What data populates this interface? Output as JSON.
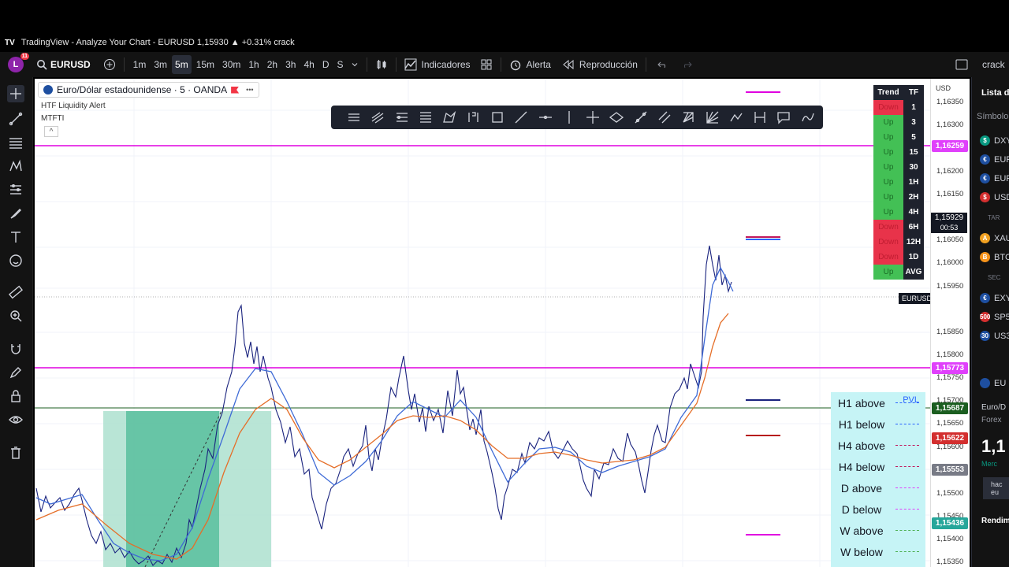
{
  "window": {
    "title": "TradingView - Analyze Your Chart - EURUSD 1,15930 ▲ +0.31% crack"
  },
  "toolbar": {
    "avatar_letter": "L",
    "avatar_badge": "11",
    "symbol": "EURUSD",
    "intervals": [
      "1m",
      "3m",
      "5m",
      "15m",
      "30m",
      "1h",
      "2h",
      "3h",
      "4h",
      "D",
      "S"
    ],
    "active_interval": "5m",
    "indicators_label": "Indicadores",
    "alert_label": "Alerta",
    "replay_label": "Reproducción",
    "right_label": "crack"
  },
  "legend": {
    "symbol_title": "Euro/Dólar estadounidense · 5 · OANDA",
    "more": "•••",
    "indicator_1": "HTF Liquidity Alert",
    "indicator_2": "MTFTI",
    "collapse": "^"
  },
  "trend_table": {
    "header_trend": "Trend",
    "header_tf": "TF",
    "rows": [
      {
        "trend": "Down",
        "tf": "1"
      },
      {
        "trend": "Up",
        "tf": "3"
      },
      {
        "trend": "Up",
        "tf": "5"
      },
      {
        "trend": "Up",
        "tf": "15"
      },
      {
        "trend": "Up",
        "tf": "30"
      },
      {
        "trend": "Up",
        "tf": "1H"
      },
      {
        "trend": "Up",
        "tf": "2H"
      },
      {
        "trend": "Up",
        "tf": "4H"
      },
      {
        "trend": "Down",
        "tf": "6H"
      },
      {
        "trend": "Down",
        "tf": "12H"
      },
      {
        "trend": "Down",
        "tf": "1D"
      },
      {
        "trend": "Up",
        "tf": "AVG"
      }
    ]
  },
  "levels": {
    "pvl": "PVL",
    "rows": [
      {
        "label": "H1 above",
        "color": "#2962ff"
      },
      {
        "label": "H1 below",
        "color": "#2962ff"
      },
      {
        "label": "H4 above",
        "color": "#c2185b"
      },
      {
        "label": "H4 below",
        "color": "#c2185b"
      },
      {
        "label": "D above",
        "color": "#e040fb"
      },
      {
        "label": "D below",
        "color": "#e040fb"
      },
      {
        "label": "W above",
        "color": "#4caf50"
      },
      {
        "label": "W below",
        "color": "#4caf50"
      }
    ]
  },
  "price_axis": {
    "currency": "USD",
    "ticks": [
      "1,16350",
      "1,16300",
      "1,16250",
      "1,16200",
      "1,16150",
      "1,16100",
      "1,16050",
      "1,16000",
      "1,15950",
      "1,15850",
      "1,15800",
      "1,15750",
      "1,15700",
      "1,15650",
      "1,15600",
      "1,15500",
      "1,15450",
      "1,15400",
      "1,15350"
    ],
    "tags": [
      {
        "text": "1,16259",
        "color": "#e040fb"
      },
      {
        "text": "1,15773",
        "color": "#e040fb"
      },
      {
        "text": "1,15687",
        "color": "#1b5e20"
      },
      {
        "text": "1,15622",
        "color": "#d32f2f"
      },
      {
        "text": "1,15553",
        "color": "#787b86"
      },
      {
        "text": "1,15436",
        "color": "#26a69a"
      }
    ],
    "symbol_tag": "EURUSD",
    "current_price": "1,15929",
    "countdown": "00:53"
  },
  "watchlist": {
    "title": "Lista d",
    "search": "Símbolo",
    "items": [
      {
        "icon": "$",
        "color": "#089981",
        "text": "DXY"
      },
      {
        "icon": "€",
        "color": "#1e4fa0",
        "text": "EUR"
      },
      {
        "icon": "€",
        "color": "#1e4fa0",
        "text": "EUR"
      },
      {
        "icon": "$",
        "color": "#d32f2f",
        "text": "USD"
      },
      {
        "icon": "",
        "color": "",
        "text": "TAR"
      },
      {
        "icon": "A",
        "color": "#f0a020",
        "text": "XAU"
      },
      {
        "icon": "B",
        "color": "#f7931a",
        "text": "BTC"
      },
      {
        "icon": "",
        "color": "",
        "text": "SEC"
      },
      {
        "icon": "€",
        "color": "#1e4fa0",
        "text": "EXY"
      },
      {
        "icon": "500",
        "color": "#d32f2f",
        "text": "SP5"
      },
      {
        "icon": "30",
        "color": "#1e4fa0",
        "text": "US3"
      }
    ],
    "detail_symbol": "EU",
    "detail_name": "Euro/D",
    "detail_type": "Forex",
    "detail_price": "1,1",
    "detail_status": "Merc",
    "detail_promo": "hac eu",
    "detail_perf": "Rendim"
  }
}
